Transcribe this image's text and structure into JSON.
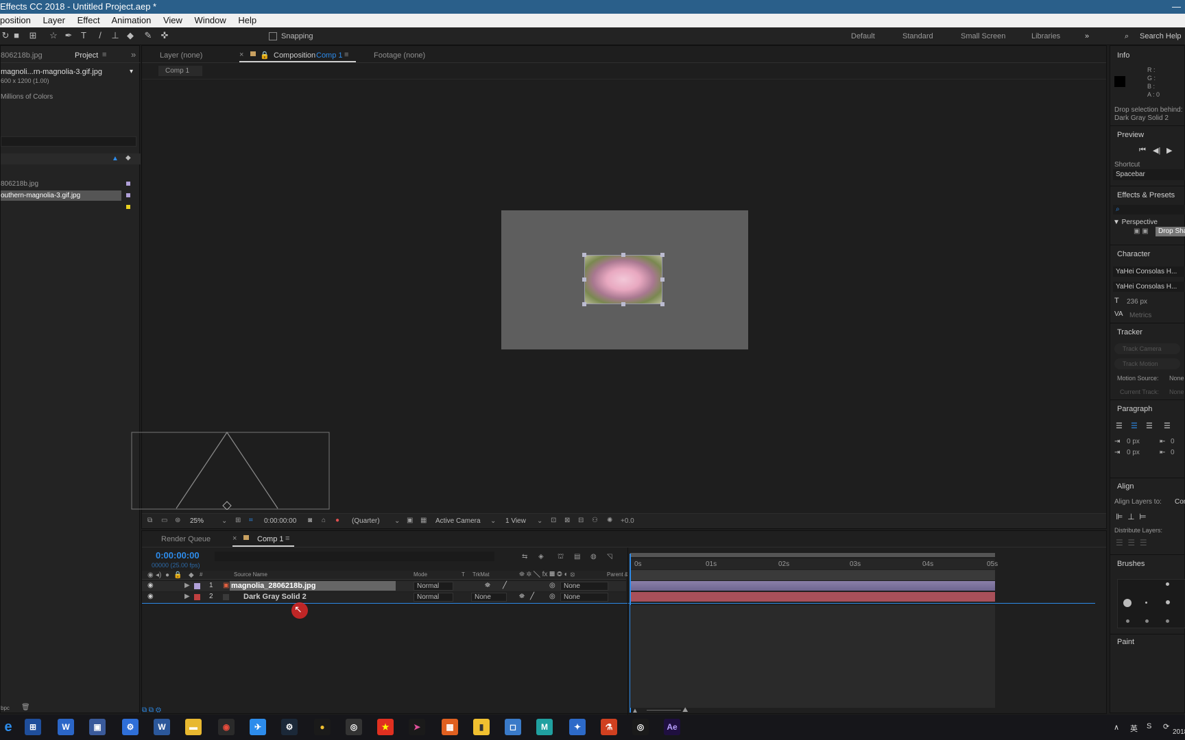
{
  "window": {
    "title": "Effects CC 2018 - Untitled Project.aep *",
    "controls": "—"
  },
  "menu": [
    "position",
    "Layer",
    "Effect",
    "Animation",
    "View",
    "Window",
    "Help"
  ],
  "toolbar": {
    "snapping": "Snapping",
    "workspaces": [
      "Default",
      "Standard",
      "Small Screen",
      "Libraries"
    ],
    "search_help": "Search Help"
  },
  "project": {
    "tab_prev": "806218b.jpg",
    "tab_label": "Project",
    "selected_name": "magnoli...rn-magnolia-3.gif.jpg",
    "dimensions": "600 x 1200 (1.00)",
    "color_depth": "Millions of Colors",
    "items": [
      "806218b.jpg",
      "outhern-magnolia-3.gif.jpg"
    ],
    "footer_bpc": "bpc"
  },
  "viewer": {
    "tabs": {
      "layer": "Layer (none)",
      "composition": "Composition",
      "comp_name": "Comp 1",
      "footage": "Footage (none)"
    },
    "breadcrumb": "Comp 1",
    "zoom": "25%",
    "timecode": "0:00:00:00",
    "resolution": "(Quarter)",
    "camera": "Active Camera",
    "views": "1 View",
    "exposure": "+0.0"
  },
  "timeline": {
    "tabs": {
      "render_queue": "Render Queue",
      "comp": "Comp 1"
    },
    "time": "0:00:00:00",
    "fps": "00000 (25.00 fps)",
    "columns": {
      "num": "#",
      "source": "Source Name",
      "mode": "Mode",
      "t": "T",
      "trkmat": "TrkMat",
      "parent": "Parent & Link"
    },
    "layers": [
      {
        "num": "1",
        "name": "magnolia_2806218b.jpg",
        "mode": "Normal",
        "trkmat": "",
        "parent": "None",
        "label_color": "#b0a0d8"
      },
      {
        "num": "2",
        "name": "Dark Gray Solid 2",
        "mode": "Normal",
        "trkmat": "None",
        "parent": "None",
        "label_color": "#c04040"
      }
    ],
    "ruler": [
      "0s",
      "01s",
      "02s",
      "03s",
      "04s",
      "05s"
    ]
  },
  "right_panels": {
    "info": {
      "title": "Info",
      "r": "R :",
      "g": "G :",
      "b": "B :",
      "a": "A : 0",
      "msg1": "Drop selection behind:",
      "msg2": "Dark Gray Solid 2"
    },
    "preview": {
      "title": "Preview",
      "shortcut_label": "Shortcut",
      "shortcut_value": "Spacebar"
    },
    "effects": {
      "title": "Effects & Presets",
      "category": "▼ Perspective",
      "effect": "Drop Sha"
    },
    "character": {
      "title": "Character",
      "font1": "YaHei Consolas H...",
      "font2": "YaHei Consolas H...",
      "size": "236 px",
      "kerning": "Metrics"
    },
    "tracker": {
      "title": "Tracker",
      "track_camera": "Track Camera",
      "track_motion": "Track Motion",
      "motion_source_label": "Motion Source:",
      "motion_source": "None",
      "current_track_label": "Current Track:",
      "current_track": "None"
    },
    "paragraph": {
      "title": "Paragraph",
      "indent1": "0 px",
      "indent2": "0 px",
      "indent3": "0",
      "indent4": "0"
    },
    "align": {
      "title": "Align",
      "align_to_label": "Align Layers to:",
      "align_to": "Com",
      "distribute": "Distribute Layers:"
    },
    "brushes": {
      "title": "Brushes"
    },
    "paint": {
      "title": "Paint"
    }
  },
  "taskbar": {
    "lang": "英",
    "time": "2018"
  }
}
